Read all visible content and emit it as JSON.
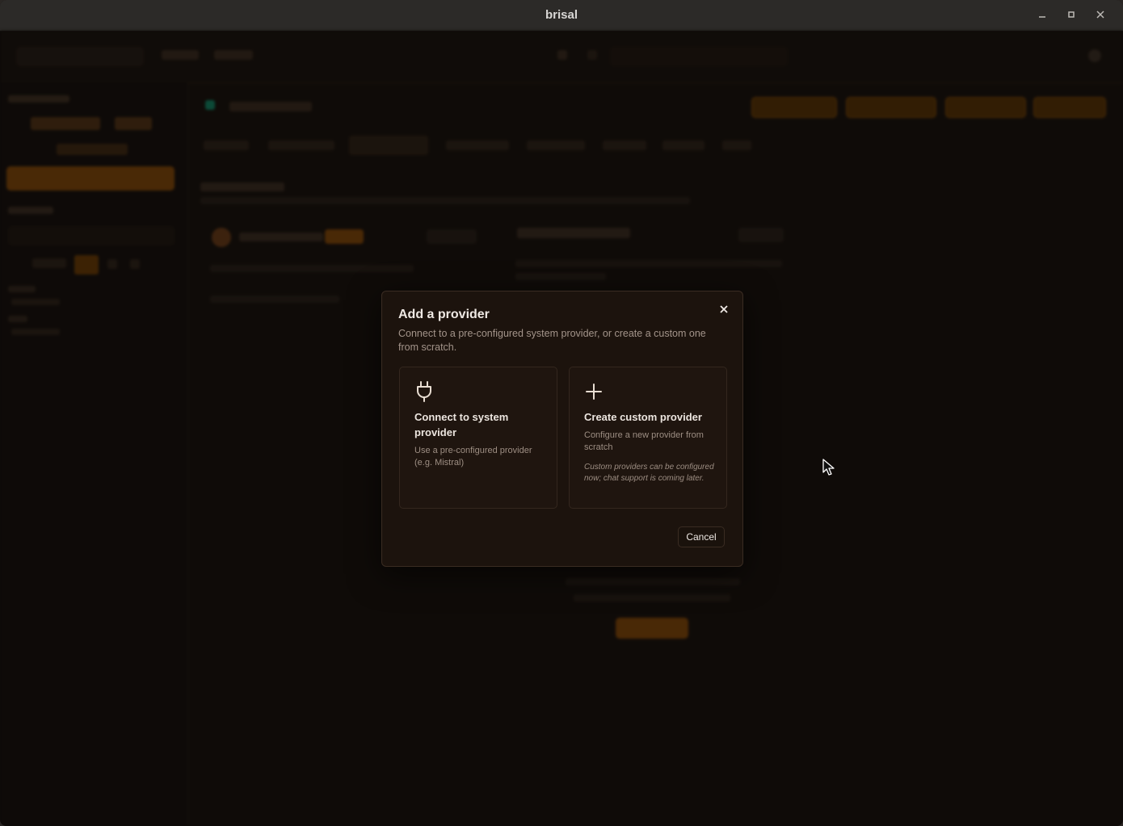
{
  "window": {
    "title": "brisal",
    "controls": {
      "minimize": "–",
      "maximize": "▫",
      "close": "✕"
    }
  },
  "dialog": {
    "title": "Add a provider",
    "description": "Connect to a pre-configured system provider, or create a custom one from scratch.",
    "close_icon": "close-icon",
    "options": [
      {
        "icon": "plug-icon",
        "title": "Connect to system provider",
        "description": "Use a pre-configured provider (e.g. Mistral)"
      },
      {
        "icon": "plus-icon",
        "title": "Create custom provider",
        "description": "Configure a new provider from scratch",
        "note": "Custom providers can be configured now; chat support is coming later."
      }
    ],
    "cancel_label": "Cancel"
  },
  "colors": {
    "accent": "#c77a1e",
    "dialog_bg": "#1c130d",
    "backdrop": "#130e0a"
  }
}
